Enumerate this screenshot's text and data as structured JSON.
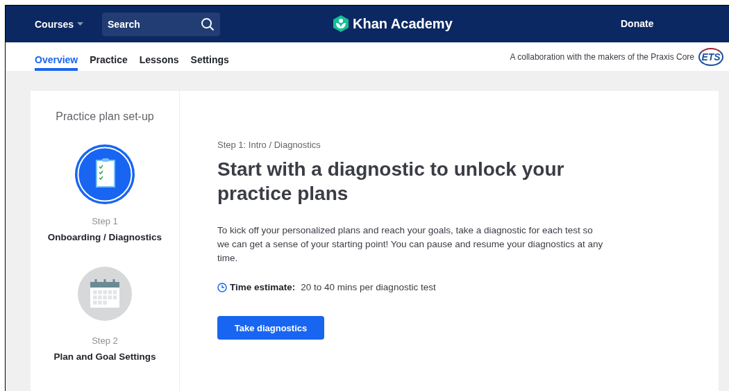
{
  "top_nav": {
    "courses": "Courses",
    "search": {
      "placeholder": "Search"
    },
    "logo": "Khan Academy",
    "donate": "Donate"
  },
  "tabs": [
    {
      "label": "Overview",
      "selected": true
    },
    {
      "label": "Practice",
      "selected": false
    },
    {
      "label": "Lessons",
      "selected": false
    },
    {
      "label": "Settings",
      "selected": false
    }
  ],
  "collaboration": {
    "text": "A collaboration with the makers of the Praxis Core",
    "logo": "ETS"
  },
  "sidebar": {
    "title": "Practice plan set-up",
    "steps": [
      {
        "kind": "clipboard",
        "active": true,
        "step": "Step 1",
        "label": "Onboarding / Diagnostics"
      },
      {
        "kind": "calendar",
        "active": false,
        "step": "Step 2",
        "label": "Plan and Goal Settings"
      }
    ]
  },
  "main": {
    "breadcrumb": "Step 1: Intro / Diagnostics",
    "heading": "Start with a diagnostic to unlock your practice plans",
    "body": "To kick off your personalized plans and reach your goals, take a diagnostic for each test so we can get a sense of your starting point! You can pause and resume your diagnostics at any time.",
    "time_label": "Time estimate:",
    "time_value": "20 to 40 mins per diagnostic test",
    "button": "Take diagnostics"
  }
}
